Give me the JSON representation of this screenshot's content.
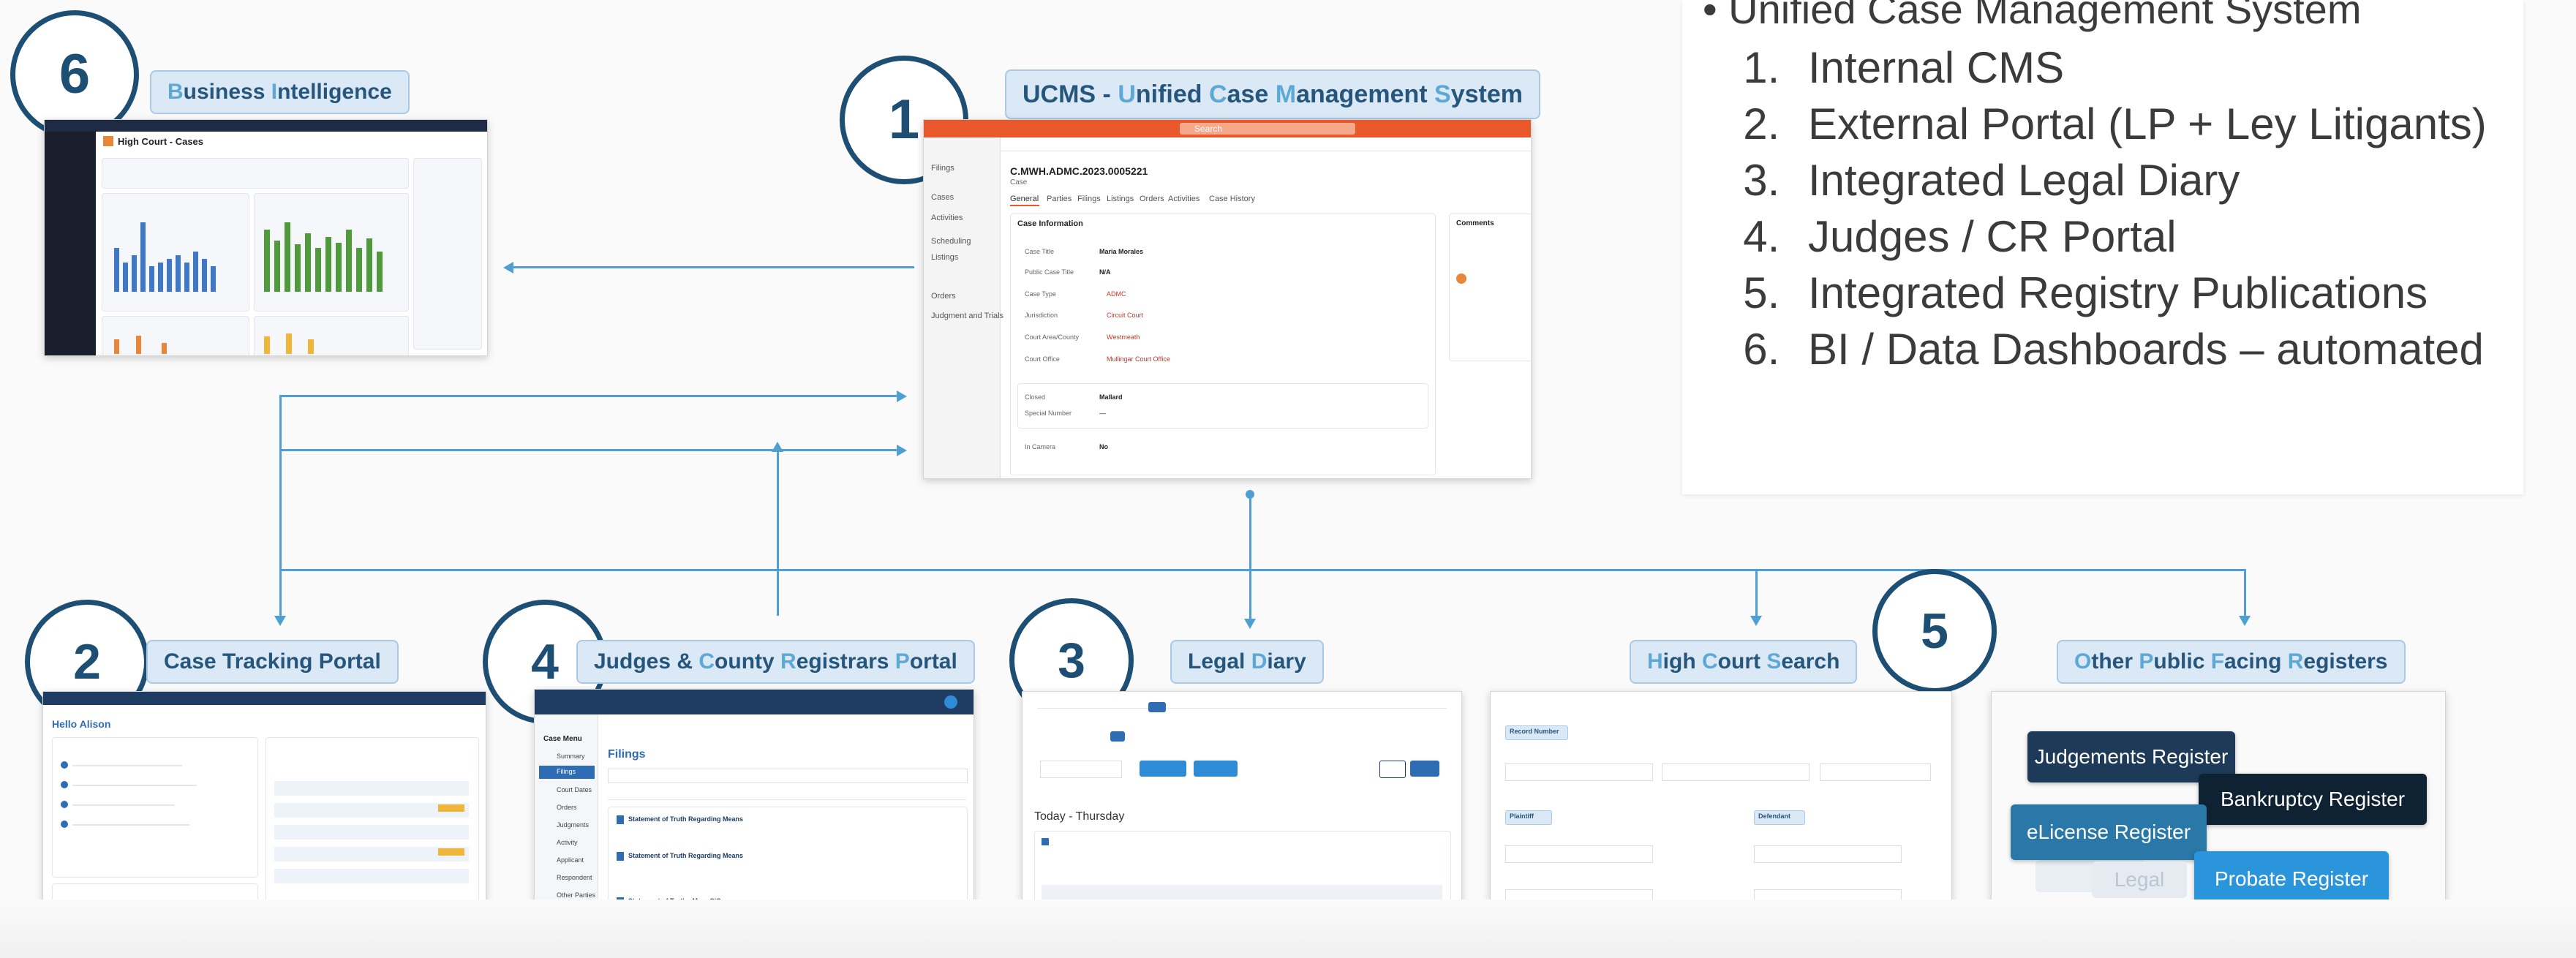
{
  "legend": {
    "heading": "Unified Case Management System",
    "items": [
      "Internal CMS",
      "External Portal (LP + Ley Litigants)",
      "Integrated Legal Diary",
      "Judges / CR Portal",
      "Integrated Registry Publications",
      "BI / Data Dashboards – automated"
    ]
  },
  "nodes": {
    "n1": {
      "number": "1",
      "title_parts": [
        "UCMS - ",
        "U",
        "nified ",
        "C",
        "ase ",
        "M",
        "anagement ",
        "S",
        "ystem"
      ]
    },
    "n2": {
      "number": "2",
      "title": "Case Tracking Portal"
    },
    "n3": {
      "number": "3",
      "title_a": "Legal ",
      "title_b": "D",
      "title_c": "iary"
    },
    "n4": {
      "number": "4",
      "title_a": "Judges & ",
      "title_b": "C",
      "title_c": "ounty ",
      "title_d": "R",
      "title_e": "egistrars ",
      "title_f": "P",
      "title_g": "ortal"
    },
    "n5": {
      "number": "5",
      "title_a": "H",
      "title_b": "igh ",
      "title_c": "C",
      "title_d": "ourt ",
      "title_e": "S",
      "title_f": "earch"
    },
    "n6": {
      "number": "6",
      "title_a": "B",
      "title_b": "usiness ",
      "title_c": "I",
      "title_d": "ntelligence"
    },
    "n7": {
      "title_a": "O",
      "title_b": "ther ",
      "title_c": "P",
      "title_d": "ublic ",
      "title_e": "F",
      "title_f": "acing ",
      "title_g": "R",
      "title_h": "egisters"
    }
  },
  "screens": {
    "bi": {
      "title": "High Court - Cases"
    },
    "ucms": {
      "search": "Search",
      "case_id": "C.MWH.ADMC.2023.0005221",
      "case_sub": "Case",
      "tabs": [
        "General",
        "Parties",
        "Filings",
        "Listings",
        "Orders",
        "Activities",
        "Case History"
      ],
      "section": "Case Information",
      "fields": [
        {
          "label": "Case Title",
          "value": "Maria Morales"
        },
        {
          "label": "Public Case Title",
          "value": "N/A"
        },
        {
          "label": "Case Type",
          "value": "ADMC"
        },
        {
          "label": "Jurisdiction",
          "value": "Circuit Court"
        },
        {
          "label": "Court Area/County",
          "value": "Westmeath"
        },
        {
          "label": "Court Office",
          "value": "Mullingar Court Office"
        },
        {
          "label": "Closed",
          "value": "Mallard"
        },
        {
          "label": "Special Number",
          "value": "—"
        },
        {
          "label": "In Camera",
          "value": "No"
        }
      ],
      "comments": "Comments",
      "sidebar": [
        "Filings",
        "Cases",
        "Activities",
        "Scheduling",
        "Listings",
        "Orders",
        "Judgment and Trials"
      ]
    },
    "tracking": {
      "greeting": "Hello Alison"
    },
    "judges": {
      "heading": "Filings",
      "menu": [
        "Case Menu",
        "Summary",
        "Filings",
        "Court Dates",
        "Orders",
        "Judgments",
        "Activity",
        "Applicant",
        "Respondent",
        "Other Parties"
      ],
      "items": [
        "Statement of Truth Regarding Means",
        "Statement of Truth Regarding Means",
        "Statement of Truth - Mary O'Connor"
      ]
    },
    "diary": {
      "today": "Today - Thursday"
    },
    "search": {
      "record_label": "Record Number",
      "plaintiff": "Plaintiff",
      "defendant": "Defendant"
    }
  },
  "registers": {
    "judgements": "Judgements Register",
    "bankruptcy": "Bankruptcy Register",
    "elicense": "eLicense Register",
    "probate": "Probate Register",
    "legal": "Legal Cost"
  },
  "colors": {
    "accent": "#1d4e73",
    "chip_bg": "#dbe9f6",
    "line": "#4f9fd0",
    "ucms_bar": "#e8582a"
  }
}
